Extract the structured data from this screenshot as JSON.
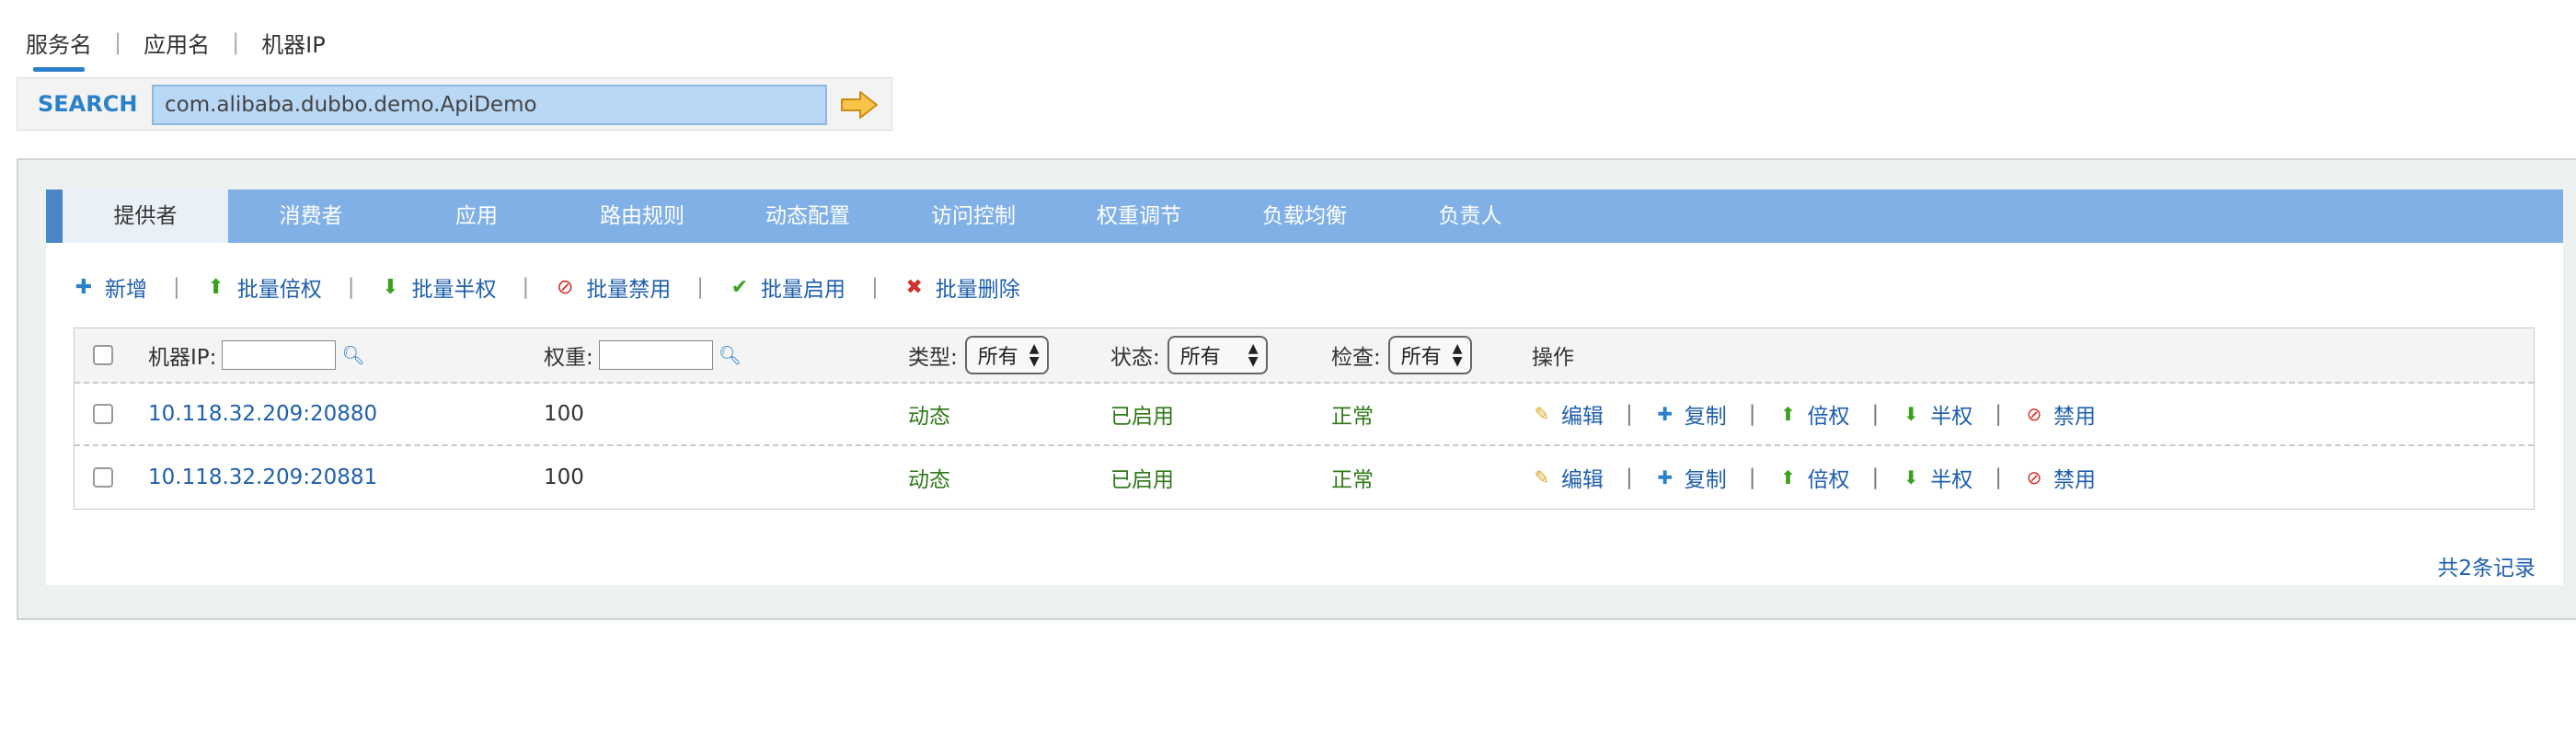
{
  "top_tabs": [
    "服务名",
    "应用名",
    "机器IP"
  ],
  "top_tab_separator": "|",
  "search": {
    "label": "SEARCH",
    "value": "com.alibaba.dubbo.demo.ApiDemo"
  },
  "tabs": [
    "提供者",
    "消费者",
    "应用",
    "路由规则",
    "动态配置",
    "访问控制",
    "权重调节",
    "负载均衡",
    "负责人"
  ],
  "toolbar": {
    "separator": "|",
    "items": [
      {
        "label": "新增",
        "icon": "plus-icon",
        "color": "#2a80c9"
      },
      {
        "label": "批量倍权",
        "icon": "arrow-up-icon",
        "color": "#3aa11c"
      },
      {
        "label": "批量半权",
        "icon": "arrow-down-icon",
        "color": "#3aa11c"
      },
      {
        "label": "批量禁用",
        "icon": "ban-icon",
        "color": "#d0312d"
      },
      {
        "label": "批量启用",
        "icon": "check-icon",
        "color": "#3aa11c"
      },
      {
        "label": "批量删除",
        "icon": "close-icon",
        "color": "#d0312d"
      }
    ]
  },
  "table": {
    "headers": {
      "ip": "机器IP:",
      "weight": "权重:",
      "type": "类型:",
      "status": "状态:",
      "check": "检查:",
      "actions": "操作"
    },
    "filter_select_value": "所有",
    "rows": [
      {
        "address": "10.118.32.209:20880",
        "weight": "100",
        "type": "动态",
        "status": "已启用",
        "check": "正常"
      },
      {
        "address": "10.118.32.209:20881",
        "weight": "100",
        "type": "动态",
        "status": "已启用",
        "check": "正常"
      }
    ],
    "row_actions": [
      {
        "label": "编辑",
        "icon": "pencil-icon"
      },
      {
        "label": "复制",
        "icon": "plus-icon"
      },
      {
        "label": "倍权",
        "icon": "arrow-up-icon"
      },
      {
        "label": "半权",
        "icon": "arrow-down-icon"
      },
      {
        "label": "禁用",
        "icon": "ban-icon"
      }
    ],
    "op_separator": "|"
  },
  "total": "共2条记录",
  "colors": {
    "accent": "#2a80c9",
    "tab_bar": "#80b0e6",
    "link": "#1f5fae",
    "status_green": "#2f7a1a"
  }
}
